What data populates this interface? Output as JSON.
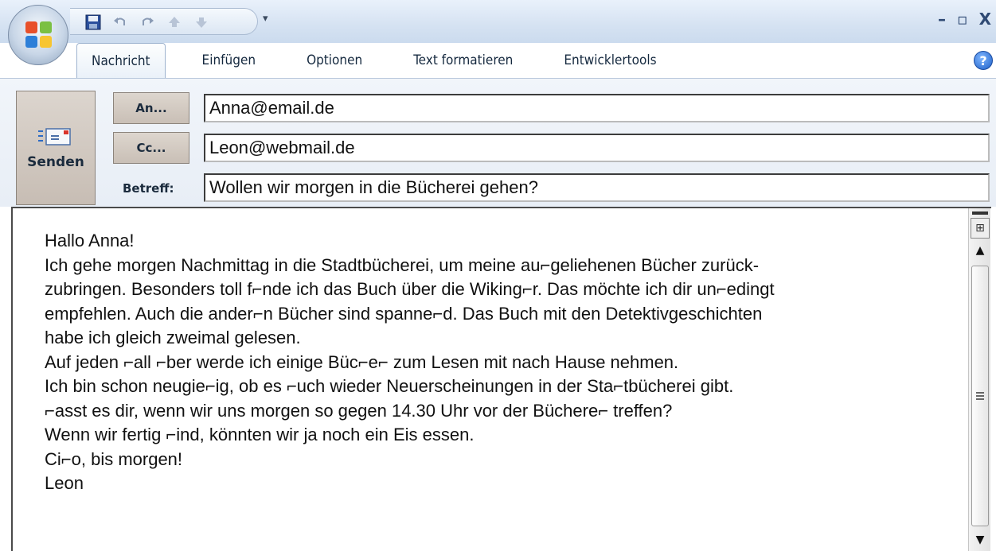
{
  "quick_access": {
    "icons": [
      "office-button-icon",
      "save-icon",
      "undo-icon",
      "redo-icon",
      "up-arrow-icon",
      "down-arrow-icon",
      "customize-dropdown-icon"
    ]
  },
  "window": {
    "minimize": "–",
    "restore": "▫",
    "close": "X"
  },
  "ribbon": {
    "tabs": [
      {
        "label": "Nachricht",
        "active": true
      },
      {
        "label": "Einfügen",
        "active": false
      },
      {
        "label": "Optionen",
        "active": false
      },
      {
        "label": "Text formatieren",
        "active": false
      },
      {
        "label": "Entwicklertools",
        "active": false
      }
    ],
    "help": "?"
  },
  "compose": {
    "send_label": "Senden",
    "to_button": "An...",
    "cc_button": "Cc...",
    "subject_label": "Betreff:",
    "to_value": "Anna@email.de",
    "cc_value": "Leon@webmail.de",
    "subject_value": "Wollen wir morgen in die Bücherei gehen?"
  },
  "message": {
    "lines": [
      "Hallo Anna!",
      "Ich gehe morgen Nachmittag in die Stadtbücherei, um meine au⌐geliehenen Bücher zurück-",
      "zubringen. Besonders toll f⌐nde ich das Buch über die Wiking⌐r. Das möchte ich dir un⌐edingt",
      "empfehlen. Auch die ander⌐n Bücher sind spanne⌐d. Das Buch mit den Detektivgeschichten",
      "habe ich gleich zweimal gelesen.",
      "Auf jeden ⌐all ⌐ber werde ich einige Büc⌐e⌐ zum Lesen mit nach Hause nehmen.",
      "Ich bin schon neugie⌐ig, ob es ⌐uch wieder Neuerscheinungen in der Sta⌐tbücherei gibt.",
      "⌐asst es dir, wenn wir uns morgen so gegen 14.30 Uhr vor der Büchere⌐ treffen?",
      "Wenn wir fertig ⌐ind, könnten wir ja noch ein Eis essen.",
      "Ci⌐o, bis morgen!",
      "Leon"
    ]
  },
  "colors": {
    "ribbon_bg": "#d6e3f3",
    "button_bg": "#c9bfb6",
    "text": "#111111"
  }
}
